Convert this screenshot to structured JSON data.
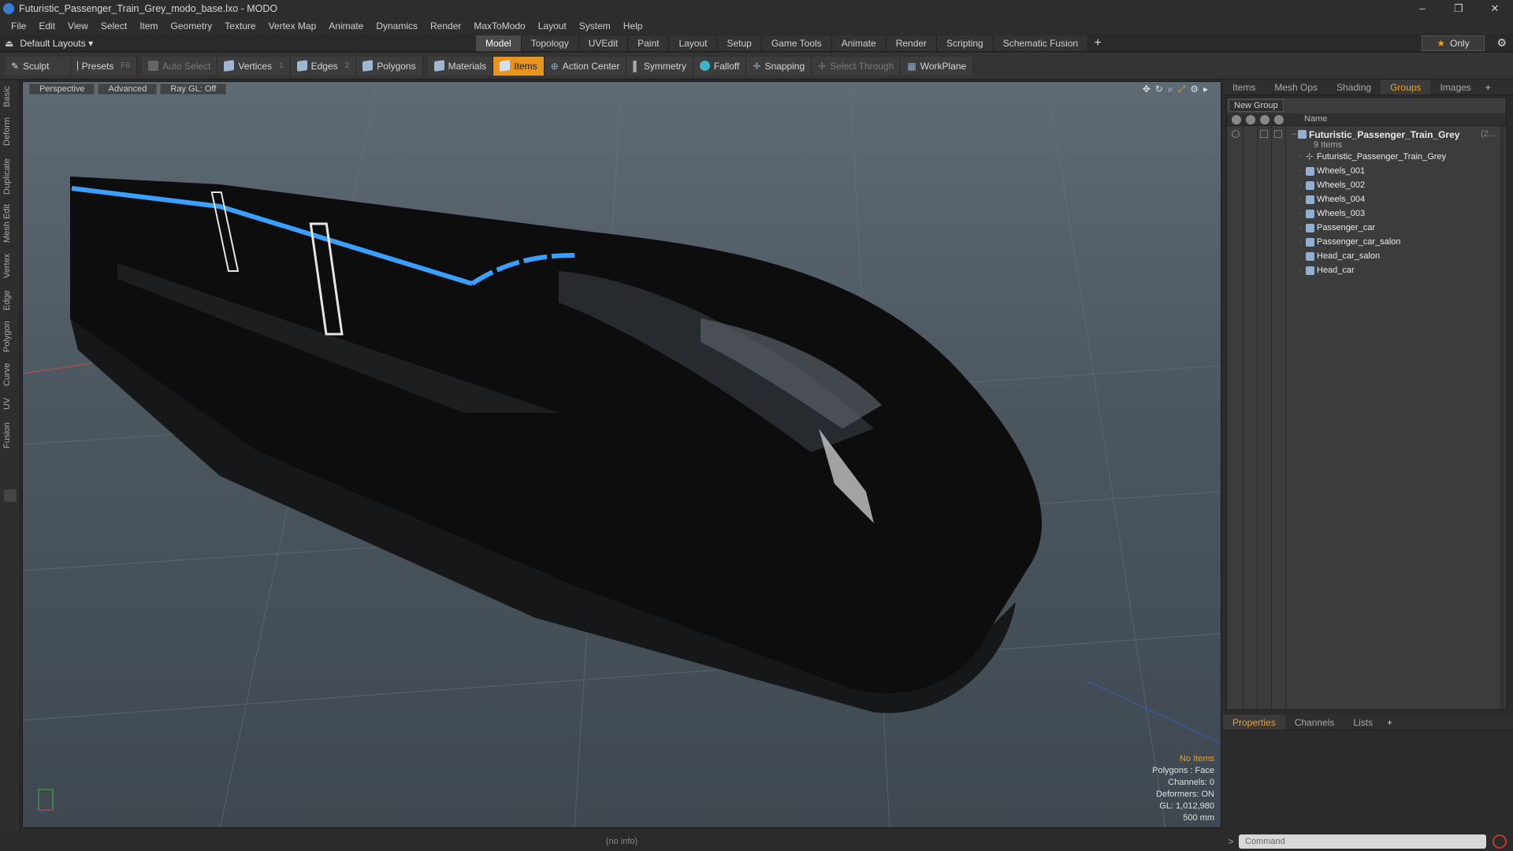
{
  "window": {
    "title": "Futuristic_Passenger_Train_Grey_modo_base.lxo - MODO",
    "controls": [
      "–",
      "❐",
      "✕"
    ]
  },
  "menu": [
    "File",
    "Edit",
    "View",
    "Select",
    "Item",
    "Geometry",
    "Texture",
    "Vertex Map",
    "Animate",
    "Dynamics",
    "Render",
    "MaxToModo",
    "Layout",
    "System",
    "Help"
  ],
  "layout_bar": {
    "layout_name": "Default Layouts",
    "tabs": [
      "Model",
      "Topology",
      "UVEdit",
      "Paint",
      "Layout",
      "Setup",
      "Game Tools",
      "Animate",
      "Render",
      "Scripting",
      "Schematic Fusion"
    ],
    "active_tab": "Model",
    "only_label": "Only"
  },
  "toolbar": {
    "sculpt": "Sculpt",
    "presets": "Presets",
    "presets_key": "F6",
    "auto_select": "Auto Select",
    "vertices": "Vertices",
    "vertices_key": "1",
    "edges": "Edges",
    "edges_key": "2",
    "polygons": "Polygons",
    "materials": "Materials",
    "items": "Items",
    "action_center": "Action Center",
    "symmetry": "Symmetry",
    "falloff": "Falloff",
    "snapping": "Snapping",
    "select_through": "Select Through",
    "workplane": "WorkPlane"
  },
  "left_tabs": [
    "Basic",
    "Deform",
    "Duplicate",
    "Mesh Edit",
    "Vertex",
    "Edge",
    "Polygon",
    "Curve",
    "UV",
    "Fusion"
  ],
  "viewport": {
    "view_name": "Perspective",
    "shading": "Advanced",
    "raygl": "Ray GL: Off",
    "info": {
      "no_items": "No Items",
      "polygons": "Polygons : Face",
      "channels": "Channels: 0",
      "deformers": "Deformers: ON",
      "gl": "GL: 1,012,980",
      "size": "500 mm"
    },
    "accent_blue": "#39a0ff",
    "body_color": "#0e0e0e"
  },
  "status": "(no info)",
  "right_panel": {
    "tabs": [
      "Items",
      "Mesh Ops",
      "Shading",
      "Groups",
      "Images"
    ],
    "active_tab": "Groups",
    "new_group": "New Group",
    "col_name": "Name",
    "root": {
      "name": "Futuristic_Passenger_Train_Grey",
      "count_suffix": "(2...",
      "items_count": "9 Items"
    },
    "children": [
      {
        "name": "Futuristic_Passenger_Train_Grey",
        "icon": "locator-icon"
      },
      {
        "name": "Wheels_001",
        "icon": "mesh-icon"
      },
      {
        "name": "Wheels_002",
        "icon": "mesh-icon"
      },
      {
        "name": "Wheels_004",
        "icon": "mesh-icon"
      },
      {
        "name": "Wheels_003",
        "icon": "mesh-icon"
      },
      {
        "name": "Passenger_car",
        "icon": "mesh-icon"
      },
      {
        "name": "Passenger_car_salon",
        "icon": "mesh-icon"
      },
      {
        "name": "Head_car_salon",
        "icon": "mesh-icon"
      },
      {
        "name": "Head_car",
        "icon": "mesh-icon"
      }
    ],
    "props_tabs": [
      "Properties",
      "Channels",
      "Lists"
    ],
    "props_active": "Properties"
  },
  "command": {
    "placeholder": "Command"
  }
}
